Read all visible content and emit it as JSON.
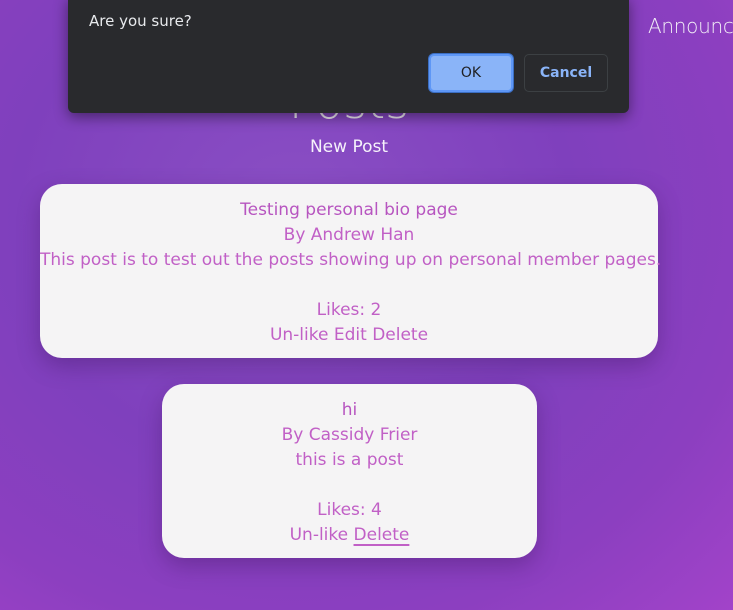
{
  "nav": {
    "announce_label": "Announce"
  },
  "page": {
    "title": "Posts",
    "new_post_label": "New Post"
  },
  "posts": [
    {
      "title": "Testing personal bio page",
      "author": "By Andrew Han",
      "body": "This post is to test out the posts showing up on personal member pages.",
      "likes": "Likes: 2",
      "actions": {
        "unlike": "Un-like",
        "edit": "Edit",
        "delete": "Delete"
      }
    },
    {
      "title": "hi",
      "author": "By Cassidy Frier",
      "body": "this is a post",
      "likes": "Likes: 4",
      "actions": {
        "unlike": "Un-like",
        "delete": "Delete"
      }
    }
  ],
  "dialog": {
    "message": "Are you sure?",
    "ok_label": "OK",
    "cancel_label": "Cancel"
  },
  "colors": {
    "accent": "#c160c6",
    "card_bg": "#f5f4f5",
    "dialog_bg": "#292a2d",
    "ok_bg": "#8ab4f8"
  }
}
